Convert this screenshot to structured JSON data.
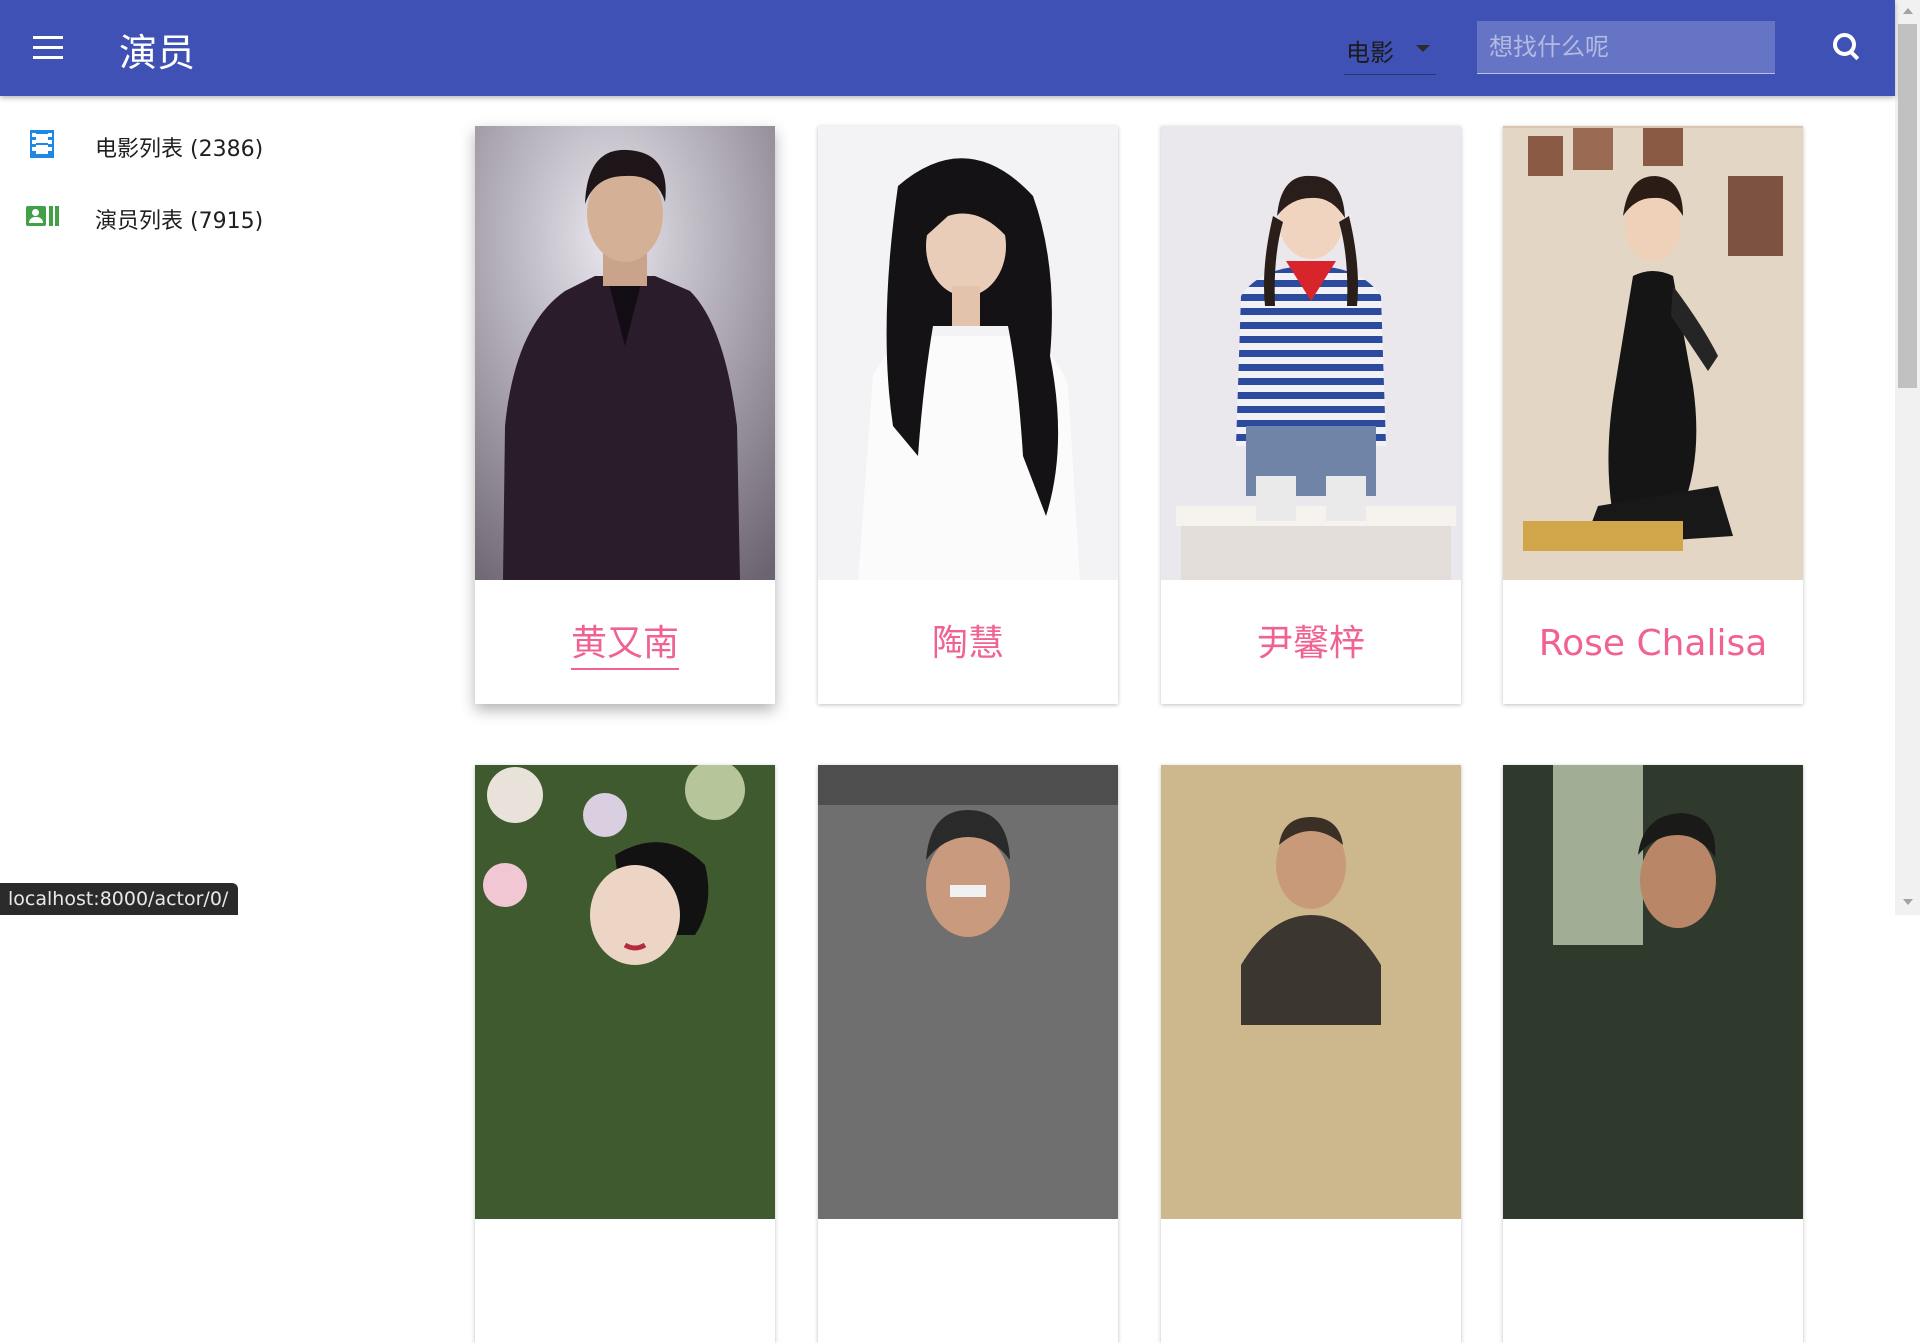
{
  "app_bar": {
    "title": "演员",
    "type_select": "电影",
    "search_placeholder": "想找什么呢"
  },
  "sidebar": {
    "items": [
      {
        "label": "电影列表 (2386)",
        "icon": "movie-film-icon"
      },
      {
        "label": "演员列表 (7915)",
        "icon": "person-card-icon"
      }
    ]
  },
  "cards": [
    {
      "name": "黄又南"
    },
    {
      "name": "陶慧"
    },
    {
      "name": "尹馨梓"
    },
    {
      "name": "Rose Chalisa"
    },
    {
      "name": ""
    },
    {
      "name": ""
    },
    {
      "name": ""
    },
    {
      "name": ""
    }
  ],
  "status_url": "localhost:8000/actor/0/",
  "colors": {
    "app_bar": "#3f51b5",
    "accent_name": "#f06292",
    "movie_icon": "#1e88e5",
    "actor_icon": "#43a047"
  }
}
